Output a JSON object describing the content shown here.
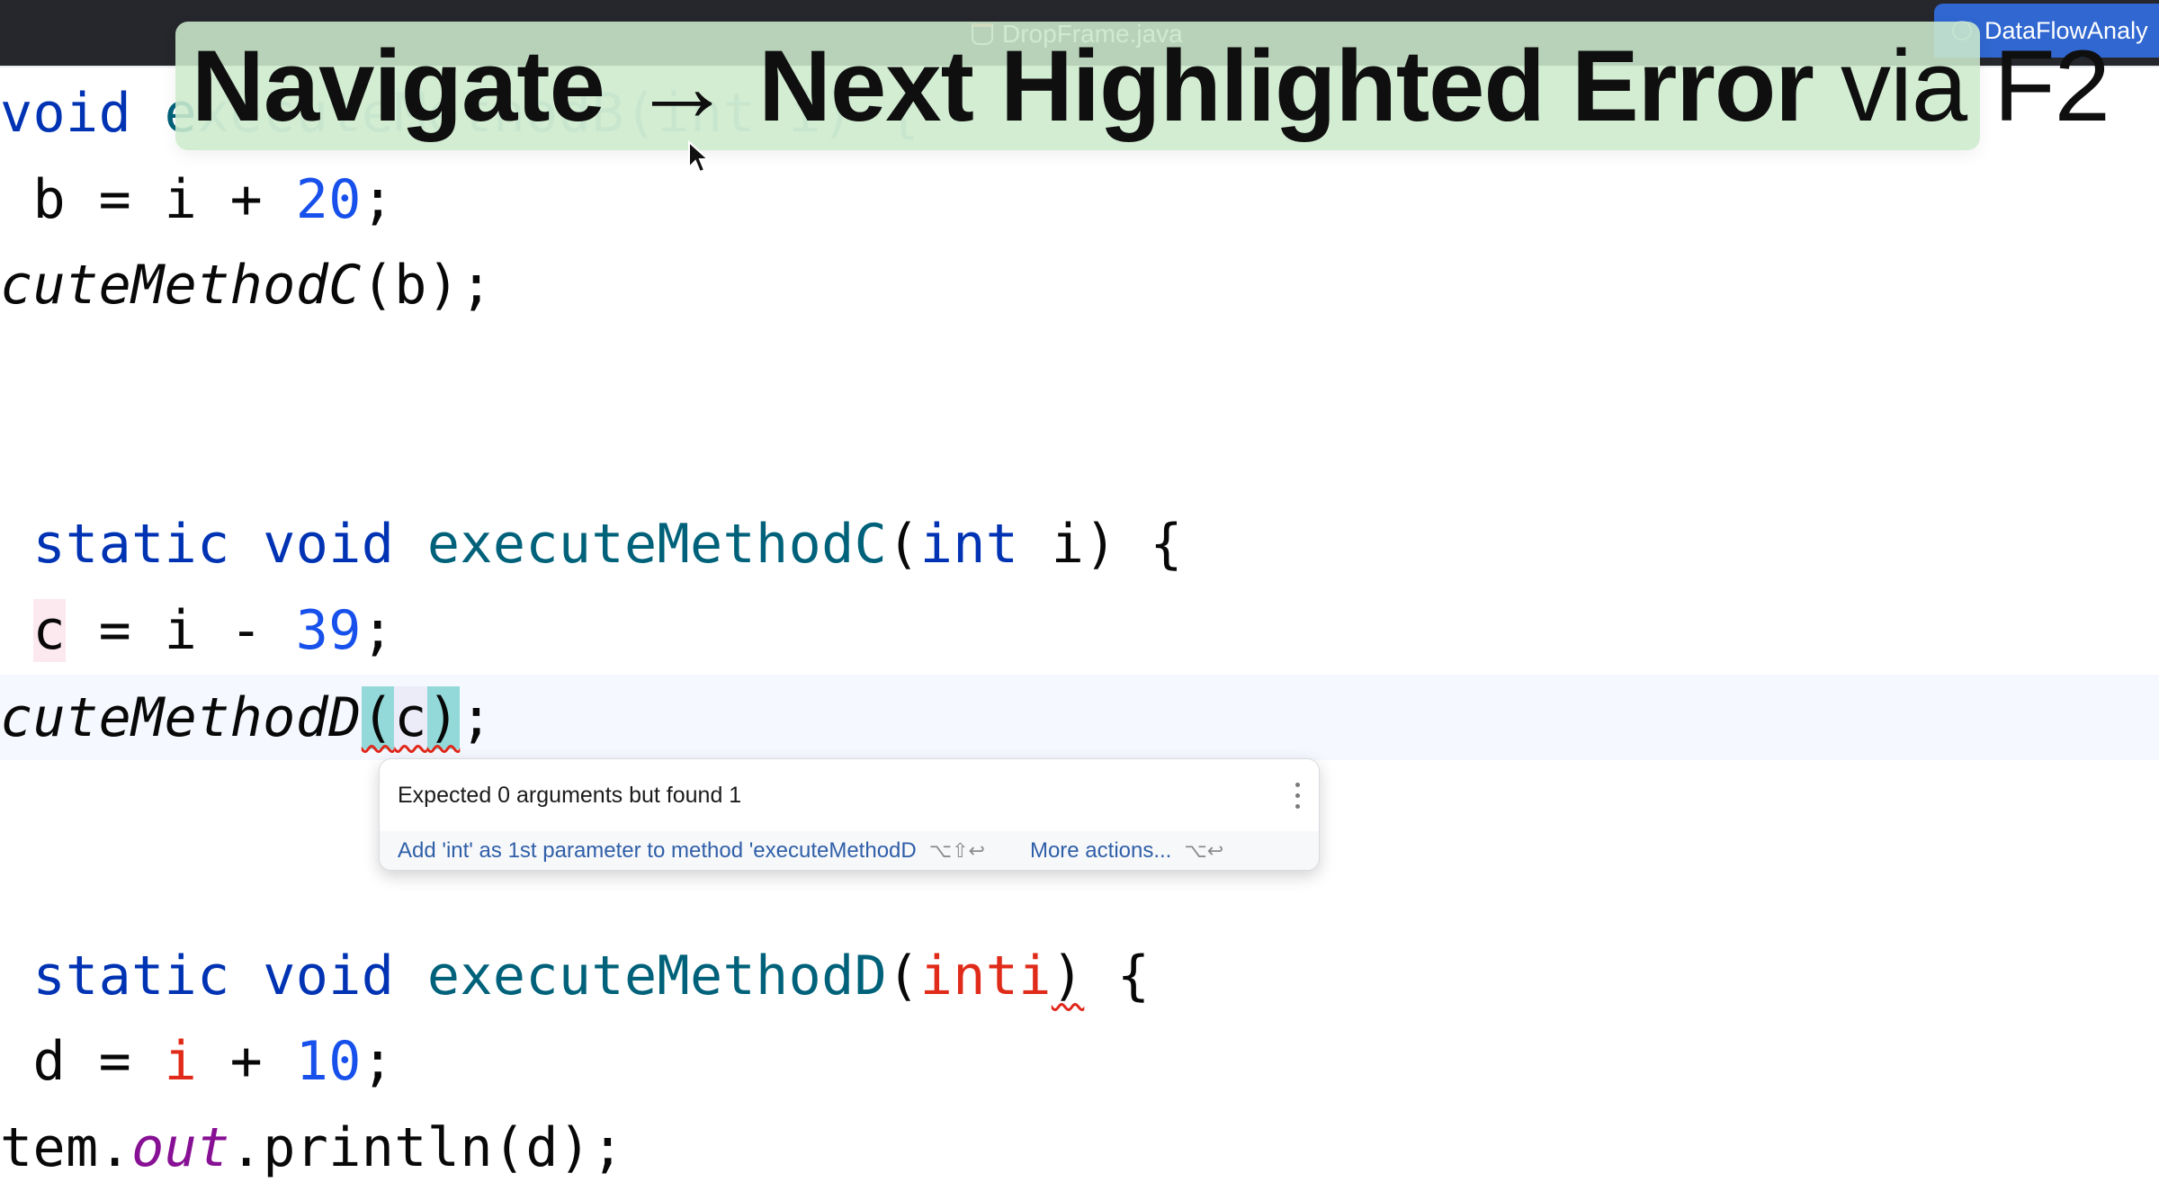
{
  "window": {
    "file_tab": "DropFrame.java",
    "run_tab": "DataFlowAnaly"
  },
  "banner": {
    "bold_text": "Navigate → Next Highlighted Error",
    "regular_text": " via F2"
  },
  "code": {
    "line1": {
      "kw": "void",
      "fn_visible": "e",
      "rest_faded": "xecuteMethodB(int i) {"
    },
    "line2": {
      "pre": " b = i + ",
      "num": "20",
      "post": ";"
    },
    "line3": {
      "call": "cuteMethodC",
      "post": "(b);"
    },
    "line4": {
      "kw1": " static",
      "kw2": " void",
      "fn": " executeMethodC",
      "open": "(",
      "kw3": "int",
      "param": " i",
      "close": ")",
      "brace": " {"
    },
    "line5": {
      "var": "c",
      "pre": " = i - ",
      "num": "39",
      "post": ";"
    },
    "line6": {
      "call": "cuteMethodD",
      "open": "(",
      "arg": "c",
      "close": ")",
      "post": ";"
    },
    "line7": {
      "kw1": " static",
      "kw2": " void",
      "fn": " executeMethodD",
      "open": "(",
      "err": "inti",
      "close": ")",
      "brace": " {"
    },
    "line8": {
      "pre": " d = ",
      "err": "i",
      "mid": " + ",
      "num": "10",
      "post": ";"
    },
    "line9": {
      "pre": "tem.",
      "field": "out",
      "post": ".println(d);"
    }
  },
  "popup": {
    "message": "Expected 0 arguments but found 1",
    "quick_fix": "Add 'int' as 1st parameter to method 'executeMethodD",
    "quick_fix_shortcut": "⌥⇧↩",
    "more_actions": "More actions...",
    "more_actions_shortcut": "⌥↩"
  }
}
